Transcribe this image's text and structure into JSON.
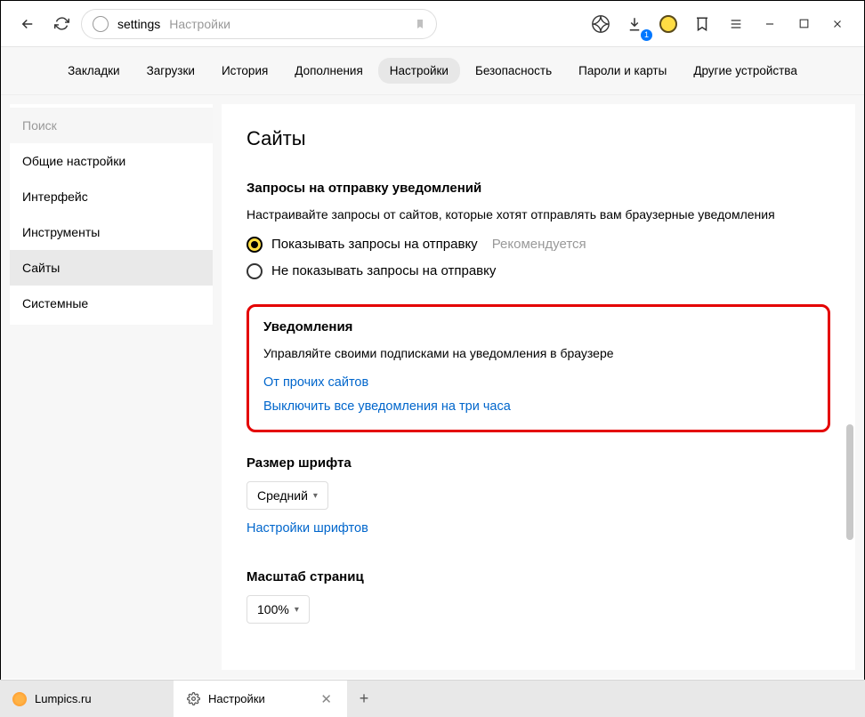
{
  "toolbar": {
    "address_prefix": "settings",
    "address_title": "Настройки",
    "download_badge": "1"
  },
  "topnav": {
    "items": [
      "Закладки",
      "Загрузки",
      "История",
      "Дополнения",
      "Настройки",
      "Безопасность",
      "Пароли и карты",
      "Другие устройства"
    ],
    "active_index": 4
  },
  "sidebar": {
    "search_placeholder": "Поиск",
    "items": [
      "Общие настройки",
      "Интерфейс",
      "Инструменты",
      "Сайты",
      "Системные"
    ],
    "active_index": 3
  },
  "main": {
    "heading": "Сайты",
    "section_requests": {
      "title": "Запросы на отправку уведомлений",
      "desc": "Настраивайте запросы от сайтов, которые хотят отправлять вам браузерные уведомления",
      "radio1": "Показывать запросы на отправку",
      "reco": "Рекомендуется",
      "radio2": "Не показывать запросы на отправку"
    },
    "section_notif": {
      "title": "Уведомления",
      "desc": "Управляйте своими подписками на уведомления в браузере",
      "link1": "От прочих сайтов",
      "link2": "Выключить все уведомления на три часа"
    },
    "section_font": {
      "title": "Размер шрифта",
      "select_value": "Средний",
      "link": "Настройки шрифтов"
    },
    "section_zoom": {
      "title": "Масштаб страниц",
      "select_value": "100%"
    }
  },
  "tabs": {
    "items": [
      {
        "label": "Lumpics.ru",
        "icon": "orange"
      },
      {
        "label": "Настройки",
        "icon": "gear"
      }
    ],
    "active_index": 1
  }
}
